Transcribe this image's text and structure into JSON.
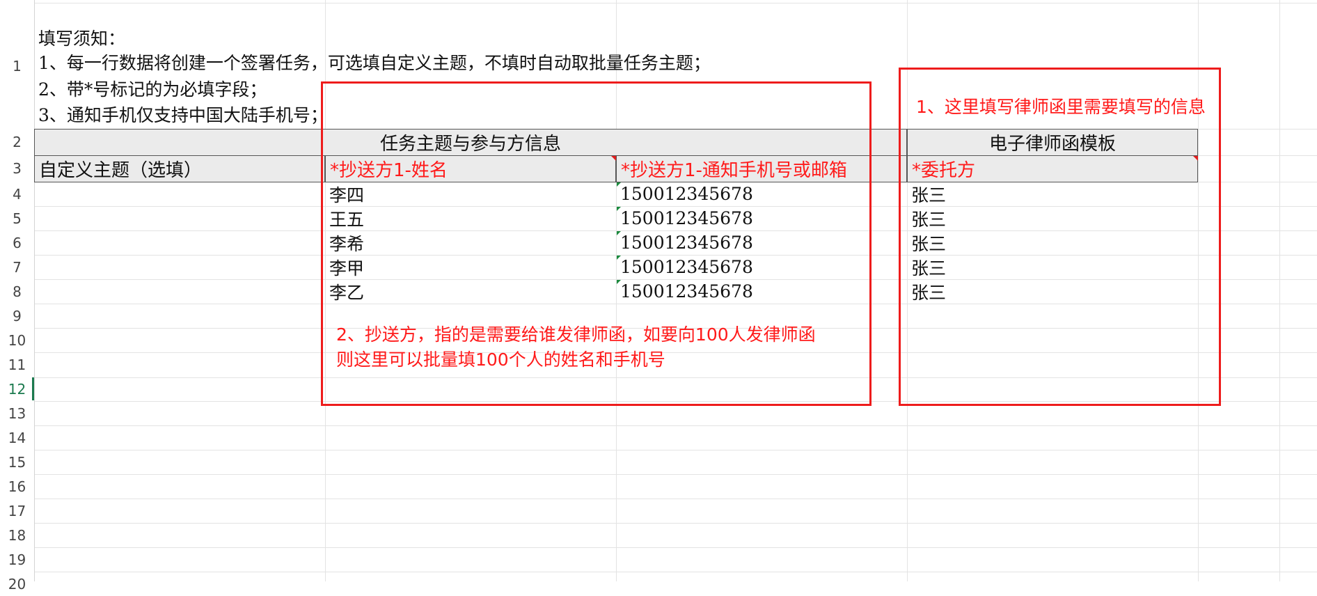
{
  "sheet": {
    "row_numbers": [
      "1",
      "2",
      "3",
      "4",
      "5",
      "6",
      "7",
      "8",
      "9",
      "10",
      "11",
      "12",
      "13",
      "14",
      "15",
      "16",
      "17",
      "18",
      "19",
      "20"
    ],
    "active_row": "12"
  },
  "instructions": {
    "title": "填写须知：",
    "line1": "1、每一行数据将创建一个签署任务，可选填自定义主题，不填时自动取批量任务主题；",
    "line2": "2、带*号标记的为必填字段；",
    "line3": "3、通知手机仅支持中国大陆手机号；"
  },
  "group_headers": {
    "task_info": "任务主题与参与方信息",
    "template": "电子律师函模板"
  },
  "columns": {
    "custom_subject": "自定义主题（选填）",
    "cc_name": "*抄送方1-姓名",
    "cc_contact": "*抄送方1-通知手机号或邮箱",
    "client": "*委托方"
  },
  "rows": [
    {
      "name": "李四",
      "phone": "150012345678",
      "client": "张三"
    },
    {
      "name": "王五",
      "phone": "150012345678",
      "client": "张三"
    },
    {
      "name": "李希",
      "phone": "150012345678",
      "client": "张三"
    },
    {
      "name": "李甲",
      "phone": "150012345678",
      "client": "张三"
    },
    {
      "name": "李乙",
      "phone": "150012345678",
      "client": "张三"
    }
  ],
  "annotations": {
    "note1": "1、这里填写律师函里需要填写的信息",
    "note2_line1": "2、抄送方，指的是需要给谁发律师函，如要向100人发律师函",
    "note2_line2": "则这里可以批量填100个人的姓名和手机号"
  },
  "colors": {
    "annotation_red": "#ee1c1c",
    "header_fill": "#ebebeb",
    "active_green": "#1b7a4e"
  }
}
